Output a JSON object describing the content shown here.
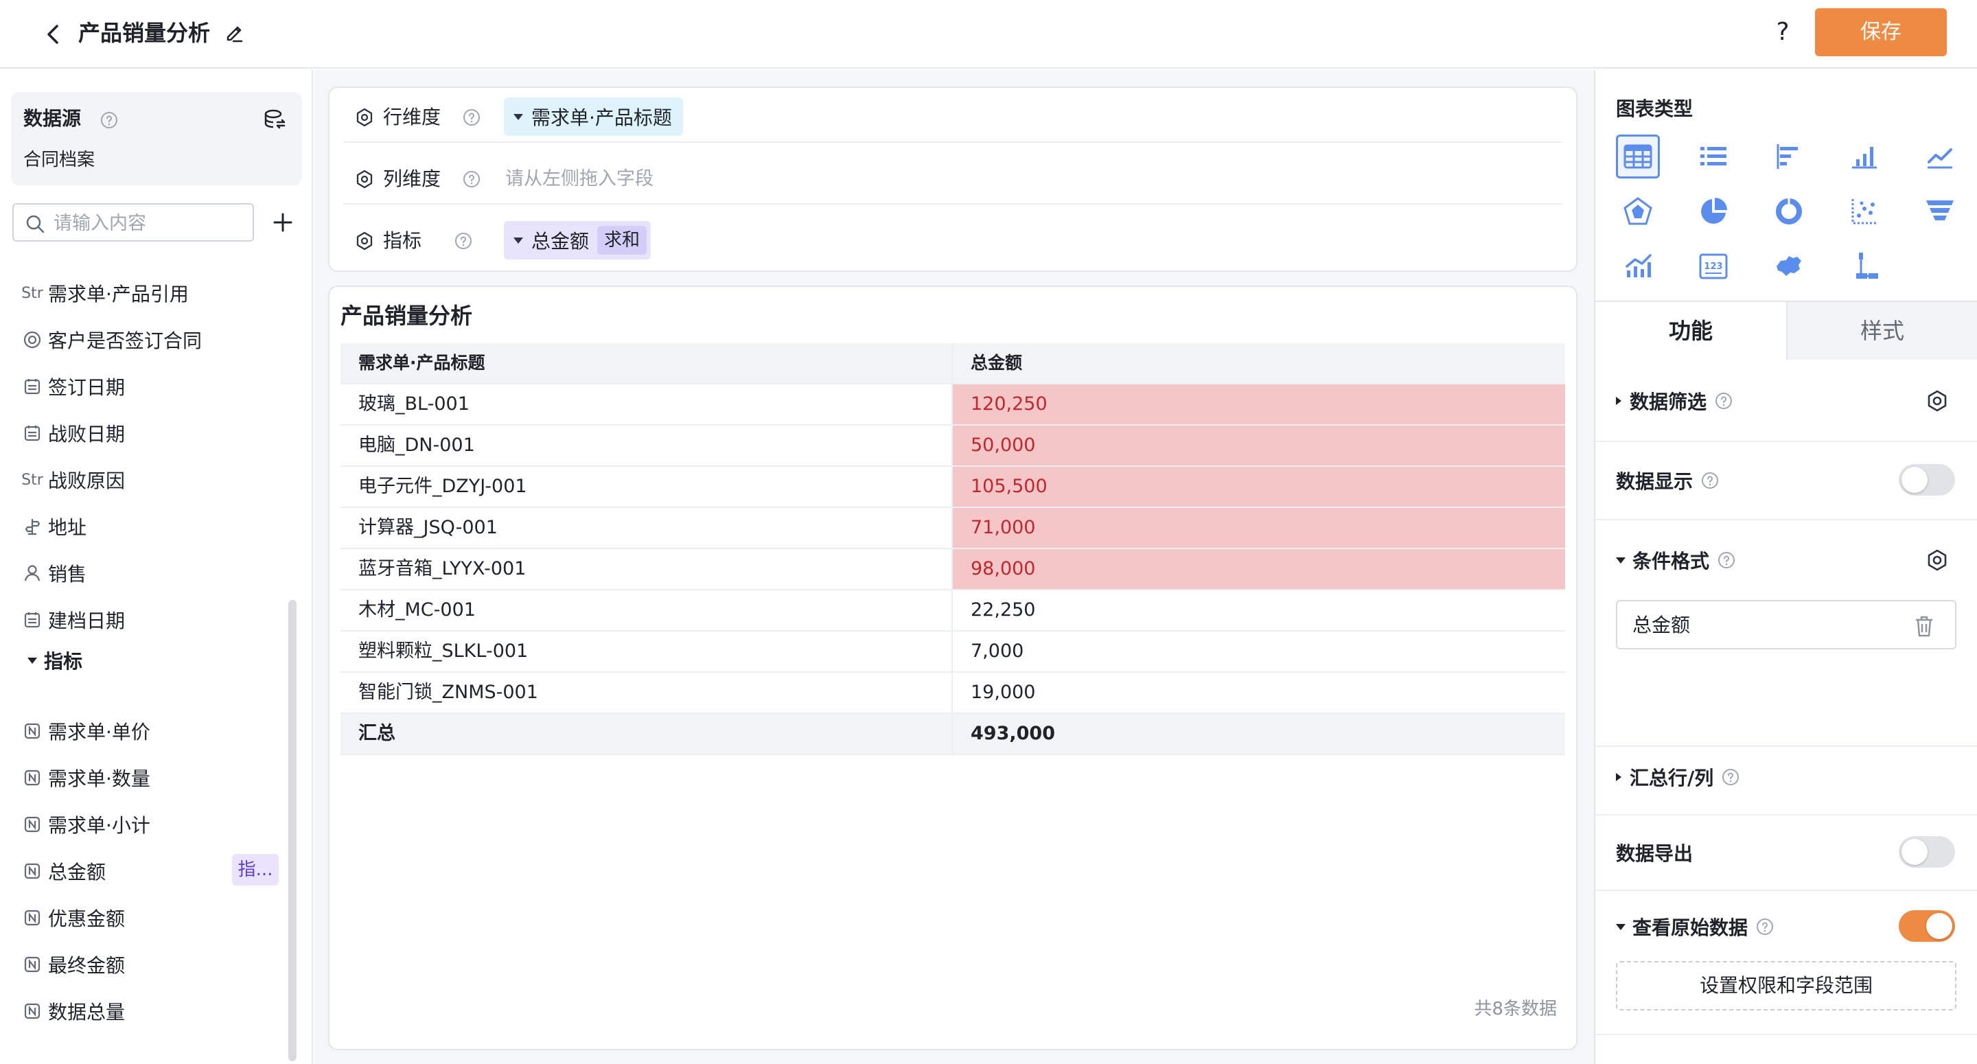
{
  "header": {
    "title": "产品销量分析",
    "help_label": "?",
    "save_label": "保存"
  },
  "datasource": {
    "title": "数据源",
    "name": "合同档案"
  },
  "search": {
    "placeholder": "请输入内容"
  },
  "fields": [
    {
      "type": "Str",
      "label": "需求单·产品引用"
    },
    {
      "type": "choice",
      "label": "客户是否签订合同"
    },
    {
      "type": "date",
      "label": "签订日期"
    },
    {
      "type": "date",
      "label": "战败日期"
    },
    {
      "type": "Str",
      "label": "战败原因"
    },
    {
      "type": "address",
      "label": "地址"
    },
    {
      "type": "person",
      "label": "销售"
    },
    {
      "type": "date",
      "label": "建档日期"
    }
  ],
  "metric_group": {
    "label": "指标"
  },
  "metrics": [
    {
      "label": "需求单·单价"
    },
    {
      "label": "需求单·数量"
    },
    {
      "label": "需求单·小计"
    },
    {
      "label": "总金额",
      "badge": "指..."
    },
    {
      "label": "优惠金额"
    },
    {
      "label": "最终金额"
    },
    {
      "label": "数据总量"
    }
  ],
  "config": {
    "row_label": "行维度",
    "row_value": "需求单·产品标题",
    "col_label": "列维度",
    "col_placeholder": "请从左侧拖入字段",
    "metric_label": "指标",
    "metric_value": "总金额",
    "metric_agg": "求和"
  },
  "table": {
    "title": "产品销量分析",
    "columns": [
      "需求单·产品标题",
      "总金额"
    ],
    "rows": [
      {
        "name": "玻璃_BL-001",
        "value": "120,250",
        "highlight": true
      },
      {
        "name": "电脑_DN-001",
        "value": "50,000",
        "highlight": true
      },
      {
        "name": "电子元件_DZYJ-001",
        "value": "105,500",
        "highlight": true
      },
      {
        "name": "计算器_JSQ-001",
        "value": "71,000",
        "highlight": true
      },
      {
        "name": "蓝牙音箱_LYYX-001",
        "value": "98,000",
        "highlight": true
      },
      {
        "name": "木材_MC-001",
        "value": "22,250",
        "highlight": false
      },
      {
        "name": "塑料颗粒_SLKL-001",
        "value": "7,000",
        "highlight": false
      },
      {
        "name": "智能门锁_ZNMS-001",
        "value": "19,000",
        "highlight": false
      }
    ],
    "total_label": "汇总",
    "total_value": "493,000",
    "row_count": "共8条数据"
  },
  "right": {
    "chart_type_title": "图表类型",
    "chart_types": [
      "table-icon",
      "list-icon",
      "bar-horizontal-icon",
      "bar-vertical-icon",
      "line-icon",
      "radar-icon",
      "pie-icon",
      "donut-icon",
      "scatter-icon",
      "funnel-icon",
      "combo-icon",
      "number-card-icon",
      "map-icon",
      "tree-icon"
    ],
    "selected_chart_type": "table-icon",
    "tab_function": "功能",
    "tab_style": "样式",
    "filter_label": "数据筛选",
    "display_label": "数据显示",
    "display_on": false,
    "cond_format_label": "条件格式",
    "cond_field": "总金额",
    "summary_label": "汇总行/列",
    "export_label": "数据导出",
    "export_on": false,
    "raw_data_label": "查看原始数据",
    "raw_data_on": true,
    "perm_button": "设置权限和字段范围"
  },
  "colors": {
    "accent": "#ef8a43",
    "highlight_bg": "#f5c6c8",
    "highlight_text": "#c0272d",
    "selected_blue": "#5b8def"
  }
}
